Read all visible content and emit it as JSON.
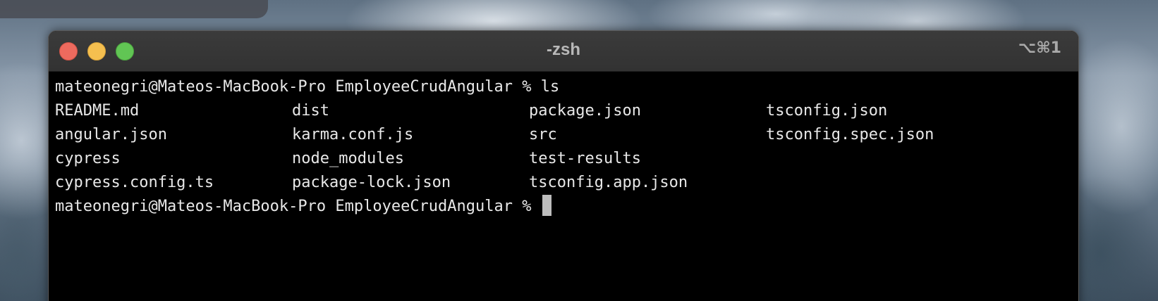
{
  "window": {
    "title": "-zsh",
    "shortcut": "⌥⌘1"
  },
  "terminal": {
    "prompt": "mateonegri@Mateos-MacBook-Pro EmployeeCrudAngular %",
    "command": "ls",
    "listing": [
      [
        "README.md",
        "dist",
        "package.json",
        "tsconfig.json"
      ],
      [
        "angular.json",
        "karma.conf.js",
        "src",
        "tsconfig.spec.json"
      ],
      [
        "cypress",
        "node_modules",
        "test-results",
        ""
      ],
      [
        "cypress.config.ts",
        "package-lock.json",
        "tsconfig.app.json",
        ""
      ]
    ]
  },
  "colors": {
    "close": "#ed6a5e",
    "minimize": "#f5bf4f",
    "zoom": "#61c554",
    "terminal_bg": "#000000",
    "terminal_fg": "#e8e8e8"
  }
}
